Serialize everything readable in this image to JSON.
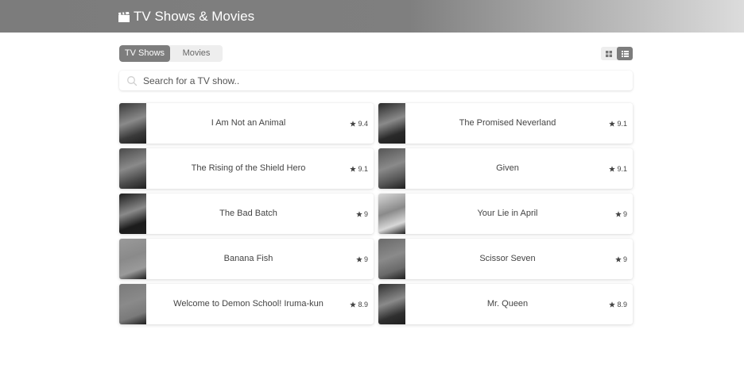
{
  "header": {
    "title": "TV Shows & Movies",
    "icon": "clapperboard-icon"
  },
  "tabs": [
    {
      "label": "TV Shows",
      "active": true
    },
    {
      "label": "Movies",
      "active": false
    }
  ],
  "view_toggle": {
    "options": [
      "grid",
      "list"
    ],
    "selected": "list"
  },
  "search": {
    "placeholder": "Search for a TV show.."
  },
  "shows": [
    {
      "title": "I Am Not an Animal",
      "rating": "9.4",
      "poster_tone": "#3a3a3a"
    },
    {
      "title": "The Promised Neverland",
      "rating": "9.1",
      "poster_tone": "#2a2a2a"
    },
    {
      "title": "The Rising of the Shield Hero",
      "rating": "9.1",
      "poster_tone": "#4a4a4a"
    },
    {
      "title": "Given",
      "rating": "9.1",
      "poster_tone": "#555555"
    },
    {
      "title": "The Bad Batch",
      "rating": "9",
      "poster_tone": "#1c1c1c"
    },
    {
      "title": "Your Lie in April",
      "rating": "9",
      "poster_tone": "#d8d8d8"
    },
    {
      "title": "Banana Fish",
      "rating": "9",
      "poster_tone": "#9a9a9a"
    },
    {
      "title": "Scissor Seven",
      "rating": "9",
      "poster_tone": "#6a6a6a"
    },
    {
      "title": "Welcome to Demon School! Iruma-kun",
      "rating": "8.9",
      "poster_tone": "#7a7a7a"
    },
    {
      "title": "Mr. Queen",
      "rating": "8.9",
      "poster_tone": "#303030"
    }
  ]
}
